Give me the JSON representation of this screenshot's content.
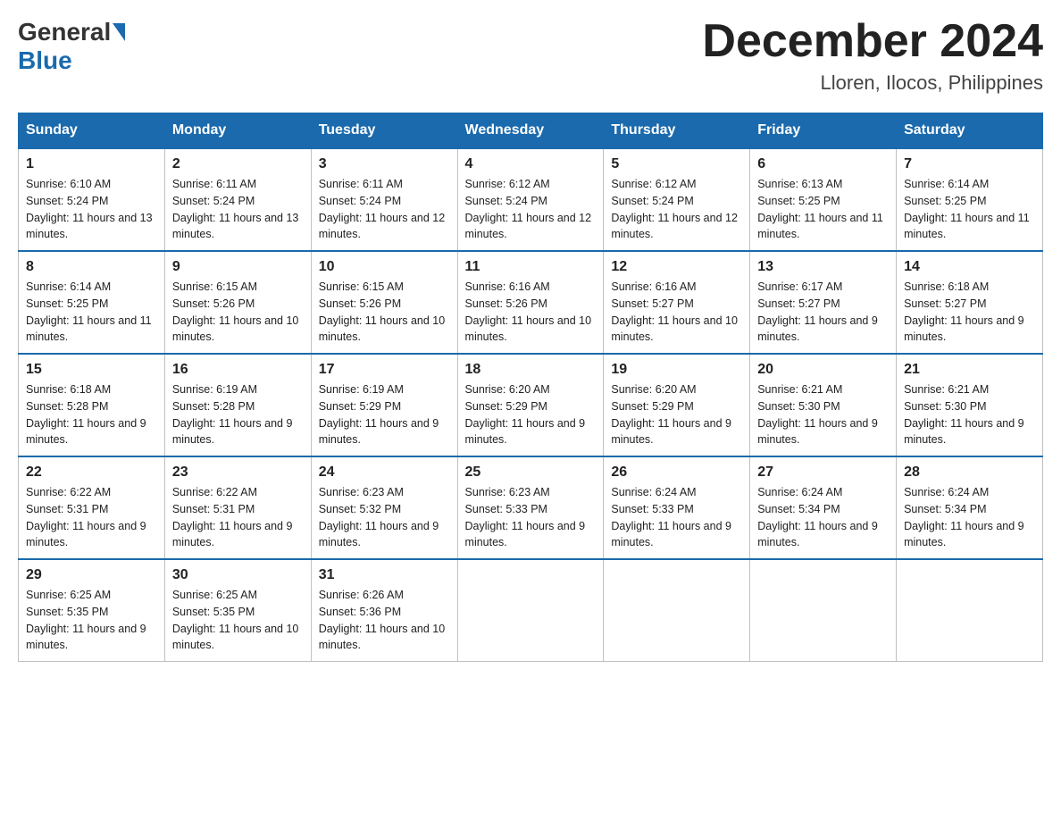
{
  "header": {
    "logo": {
      "general": "General",
      "blue": "Blue"
    },
    "title": "December 2024",
    "location": "Lloren, Ilocos, Philippines"
  },
  "weekdays": [
    "Sunday",
    "Monday",
    "Tuesday",
    "Wednesday",
    "Thursday",
    "Friday",
    "Saturday"
  ],
  "weeks": [
    [
      {
        "day": "1",
        "sunrise": "6:10 AM",
        "sunset": "5:24 PM",
        "daylight": "11 hours and 13 minutes."
      },
      {
        "day": "2",
        "sunrise": "6:11 AM",
        "sunset": "5:24 PM",
        "daylight": "11 hours and 13 minutes."
      },
      {
        "day": "3",
        "sunrise": "6:11 AM",
        "sunset": "5:24 PM",
        "daylight": "11 hours and 12 minutes."
      },
      {
        "day": "4",
        "sunrise": "6:12 AM",
        "sunset": "5:24 PM",
        "daylight": "11 hours and 12 minutes."
      },
      {
        "day": "5",
        "sunrise": "6:12 AM",
        "sunset": "5:24 PM",
        "daylight": "11 hours and 12 minutes."
      },
      {
        "day": "6",
        "sunrise": "6:13 AM",
        "sunset": "5:25 PM",
        "daylight": "11 hours and 11 minutes."
      },
      {
        "day": "7",
        "sunrise": "6:14 AM",
        "sunset": "5:25 PM",
        "daylight": "11 hours and 11 minutes."
      }
    ],
    [
      {
        "day": "8",
        "sunrise": "6:14 AM",
        "sunset": "5:25 PM",
        "daylight": "11 hours and 11 minutes."
      },
      {
        "day": "9",
        "sunrise": "6:15 AM",
        "sunset": "5:26 PM",
        "daylight": "11 hours and 10 minutes."
      },
      {
        "day": "10",
        "sunrise": "6:15 AM",
        "sunset": "5:26 PM",
        "daylight": "11 hours and 10 minutes."
      },
      {
        "day": "11",
        "sunrise": "6:16 AM",
        "sunset": "5:26 PM",
        "daylight": "11 hours and 10 minutes."
      },
      {
        "day": "12",
        "sunrise": "6:16 AM",
        "sunset": "5:27 PM",
        "daylight": "11 hours and 10 minutes."
      },
      {
        "day": "13",
        "sunrise": "6:17 AM",
        "sunset": "5:27 PM",
        "daylight": "11 hours and 9 minutes."
      },
      {
        "day": "14",
        "sunrise": "6:18 AM",
        "sunset": "5:27 PM",
        "daylight": "11 hours and 9 minutes."
      }
    ],
    [
      {
        "day": "15",
        "sunrise": "6:18 AM",
        "sunset": "5:28 PM",
        "daylight": "11 hours and 9 minutes."
      },
      {
        "day": "16",
        "sunrise": "6:19 AM",
        "sunset": "5:28 PM",
        "daylight": "11 hours and 9 minutes."
      },
      {
        "day": "17",
        "sunrise": "6:19 AM",
        "sunset": "5:29 PM",
        "daylight": "11 hours and 9 minutes."
      },
      {
        "day": "18",
        "sunrise": "6:20 AM",
        "sunset": "5:29 PM",
        "daylight": "11 hours and 9 minutes."
      },
      {
        "day": "19",
        "sunrise": "6:20 AM",
        "sunset": "5:29 PM",
        "daylight": "11 hours and 9 minutes."
      },
      {
        "day": "20",
        "sunrise": "6:21 AM",
        "sunset": "5:30 PM",
        "daylight": "11 hours and 9 minutes."
      },
      {
        "day": "21",
        "sunrise": "6:21 AM",
        "sunset": "5:30 PM",
        "daylight": "11 hours and 9 minutes."
      }
    ],
    [
      {
        "day": "22",
        "sunrise": "6:22 AM",
        "sunset": "5:31 PM",
        "daylight": "11 hours and 9 minutes."
      },
      {
        "day": "23",
        "sunrise": "6:22 AM",
        "sunset": "5:31 PM",
        "daylight": "11 hours and 9 minutes."
      },
      {
        "day": "24",
        "sunrise": "6:23 AM",
        "sunset": "5:32 PM",
        "daylight": "11 hours and 9 minutes."
      },
      {
        "day": "25",
        "sunrise": "6:23 AM",
        "sunset": "5:33 PM",
        "daylight": "11 hours and 9 minutes."
      },
      {
        "day": "26",
        "sunrise": "6:24 AM",
        "sunset": "5:33 PM",
        "daylight": "11 hours and 9 minutes."
      },
      {
        "day": "27",
        "sunrise": "6:24 AM",
        "sunset": "5:34 PM",
        "daylight": "11 hours and 9 minutes."
      },
      {
        "day": "28",
        "sunrise": "6:24 AM",
        "sunset": "5:34 PM",
        "daylight": "11 hours and 9 minutes."
      }
    ],
    [
      {
        "day": "29",
        "sunrise": "6:25 AM",
        "sunset": "5:35 PM",
        "daylight": "11 hours and 9 minutes."
      },
      {
        "day": "30",
        "sunrise": "6:25 AM",
        "sunset": "5:35 PM",
        "daylight": "11 hours and 10 minutes."
      },
      {
        "day": "31",
        "sunrise": "6:26 AM",
        "sunset": "5:36 PM",
        "daylight": "11 hours and 10 minutes."
      },
      null,
      null,
      null,
      null
    ]
  ]
}
